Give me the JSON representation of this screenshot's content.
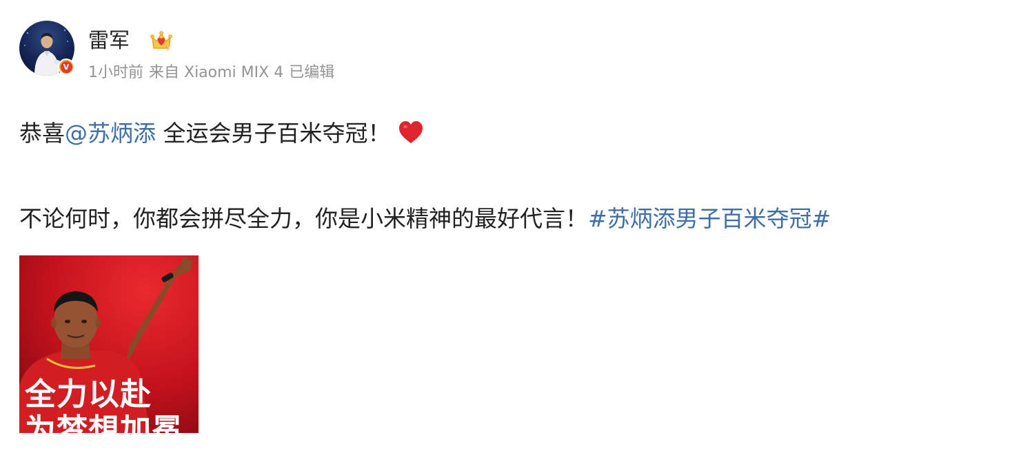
{
  "user": {
    "name": "雷军",
    "verified_badge": "V",
    "member_icon": "crown-icon"
  },
  "meta": {
    "time": "1小时前",
    "source": "来自 Xiaomi MIX 4",
    "edited": "已编辑"
  },
  "post": {
    "line1": {
      "prefix": "恭喜",
      "mention": "@苏炳添",
      "suffix": " 全运会男子百米夺冠！",
      "emoji": "heart-icon"
    },
    "line2": {
      "text": "不论何时，你都会拼尽全力，你是小米精神的最好代言！",
      "hashtag": "#苏炳添男子百米夺冠#"
    }
  },
  "image": {
    "caption_line1": "全力以赴",
    "caption_line2": "为梦想加冕"
  },
  "colors": {
    "link": "#3e6ea5",
    "meta": "#939393",
    "text": "#222222",
    "image_red": "#c3121c",
    "badge_orange": "#f5a623",
    "badge_red": "#e33a2f"
  }
}
